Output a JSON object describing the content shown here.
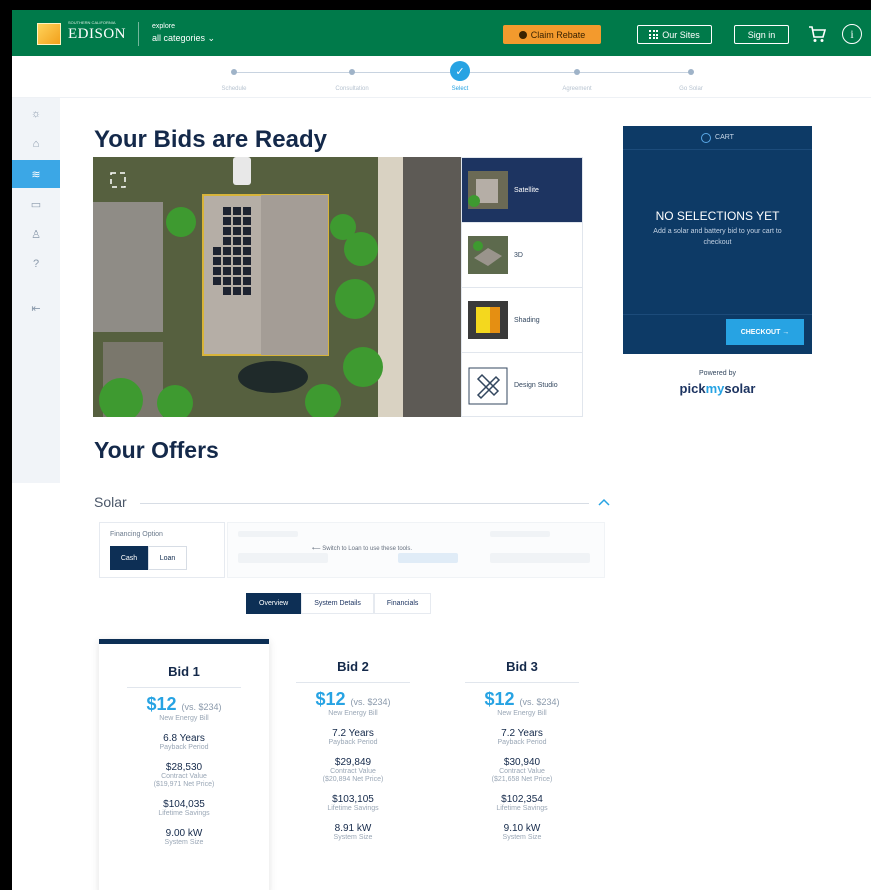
{
  "header": {
    "brand": "EDISON",
    "brand_tag": "SOUTHERN CALIFORNIA",
    "explore_label": "explore",
    "explore_value": "all categories ⌄",
    "claim_rebate": "Claim Rebate",
    "our_sites": "Our Sites",
    "sign_in": "Sign in",
    "colors": {
      "header_green": "#007a4a",
      "claim_orange": "#f39a2d"
    }
  },
  "stepper": {
    "steps": [
      "Schedule",
      "Consultation",
      "Select",
      "Agreement",
      "Go Solar"
    ],
    "current_index": 2
  },
  "sidebar": {
    "icons": [
      "sun-icon",
      "home-icon",
      "layers-icon",
      "folder-icon",
      "user-icon",
      "help-icon",
      "logout-icon"
    ],
    "active_index": 2
  },
  "main": {
    "title": "Your Bids are Ready",
    "views": [
      {
        "label": "Satellite"
      },
      {
        "label": "3D"
      },
      {
        "label": "Shading"
      },
      {
        "label": "Design Studio"
      }
    ],
    "offers_title": "Your Offers",
    "solar_label": "Solar",
    "financing": {
      "label": "Financing Option",
      "options": [
        "Cash",
        "Loan"
      ],
      "selected": "Cash",
      "switch_note": "⟵ Switch to Loan to use these tools."
    },
    "tabs": [
      "Overview",
      "System Details",
      "Financials"
    ],
    "active_tab": "Overview"
  },
  "cart": {
    "header": "CART",
    "empty_title": "NO SELECTIONS YET",
    "empty_text": "Add a solar and battery bid to your cart to checkout",
    "checkout": "CHECKOUT →",
    "powered_by": "Powered by",
    "vendor_a": "pick",
    "vendor_b": "my",
    "vendor_c": "solar"
  },
  "bids": [
    {
      "title": "Bid 1",
      "price": "$12",
      "vs": "(vs. $234)",
      "price_lbl": "New Energy Bill",
      "payback": "6.8 Years",
      "payback_lbl": "Payback Period",
      "contract": "$28,530",
      "contract_lbl": "Contract Value",
      "net": "($19,971 Net Price)",
      "savings": "$104,035",
      "savings_lbl": "Lifetime Savings",
      "size": "9.00 kW",
      "size_lbl": "System Size"
    },
    {
      "title": "Bid 2",
      "price": "$12",
      "vs": "(vs. $234)",
      "price_lbl": "New Energy Bill",
      "payback": "7.2 Years",
      "payback_lbl": "Payback Period",
      "contract": "$29,849",
      "contract_lbl": "Contract Value",
      "net": "($20,894 Net Price)",
      "savings": "$103,105",
      "savings_lbl": "Lifetime Savings",
      "size": "8.91 kW",
      "size_lbl": "System Size"
    },
    {
      "title": "Bid 3",
      "price": "$12",
      "vs": "(vs. $234)",
      "price_lbl": "New Energy Bill",
      "payback": "7.2 Years",
      "payback_lbl": "Payback Period",
      "contract": "$30,940",
      "contract_lbl": "Contract Value",
      "net": "($21,658 Net Price)",
      "savings": "$102,354",
      "savings_lbl": "Lifetime Savings",
      "size": "9.10 kW",
      "size_lbl": "System Size"
    }
  ]
}
